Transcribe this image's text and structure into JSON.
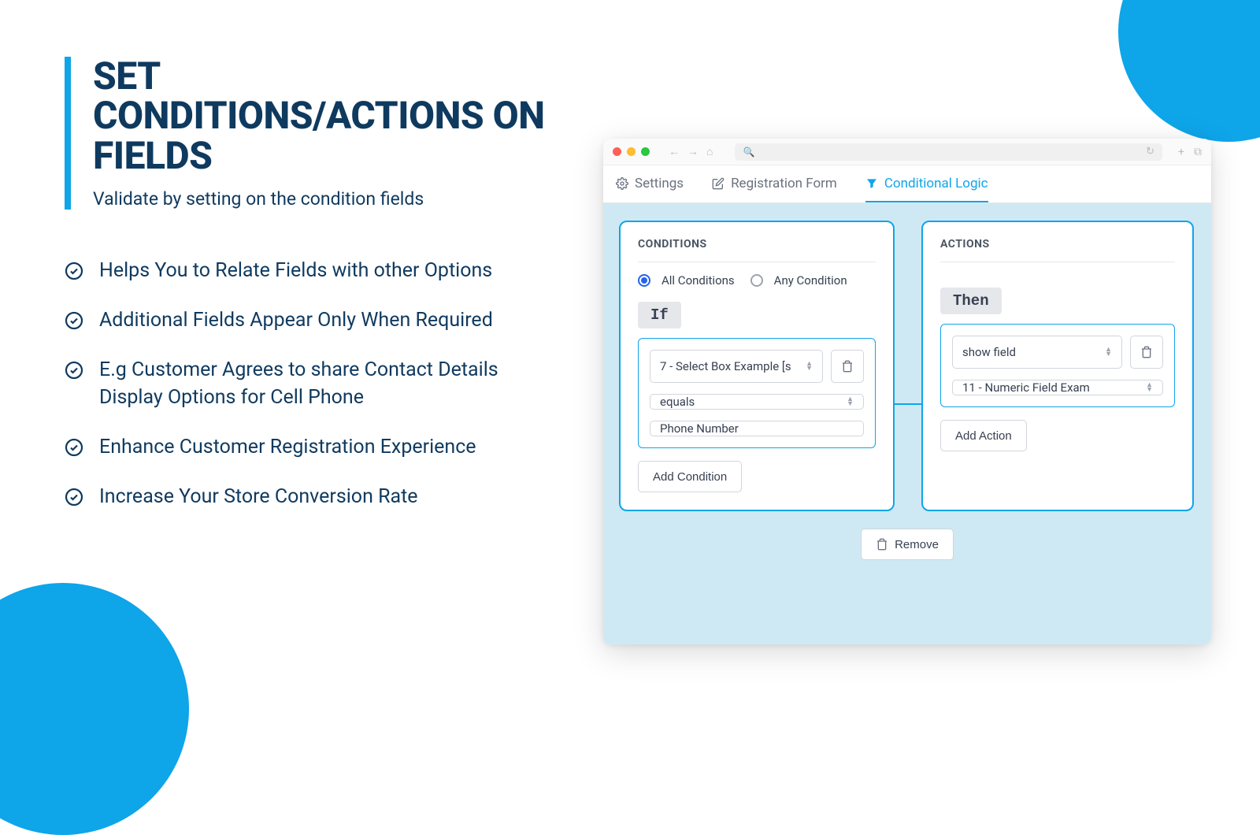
{
  "hero": {
    "title": "SET CONDITIONS/ACTIONS ON FIELDS",
    "subtitle": "Validate by setting on the condition fields"
  },
  "bullets": [
    "Helps You to Relate Fields with other Options",
    "Additional Fields Appear Only When Required",
    "E.g Customer Agrees to share Contact Details Display Options for Cell Phone",
    "Enhance Customer Registration Experience",
    "Increase Your Store Conversion Rate"
  ],
  "tabs": {
    "settings": "Settings",
    "registration": "Registration Form",
    "conditional": "Conditional Logic"
  },
  "conditions": {
    "heading": "CONDITIONS",
    "radio_all": "All Conditions",
    "radio_any": "Any Condition",
    "chip": "If",
    "field_select": "7 - Select Box Example [s",
    "operator": "equals",
    "value": "Phone Number",
    "add_btn": "Add Condition"
  },
  "actions": {
    "heading": "ACTIONS",
    "chip": "Then",
    "action_type": "show field",
    "target_field": "11 - Numeric Field Exam",
    "add_btn": "Add Action"
  },
  "remove_label": "Remove"
}
